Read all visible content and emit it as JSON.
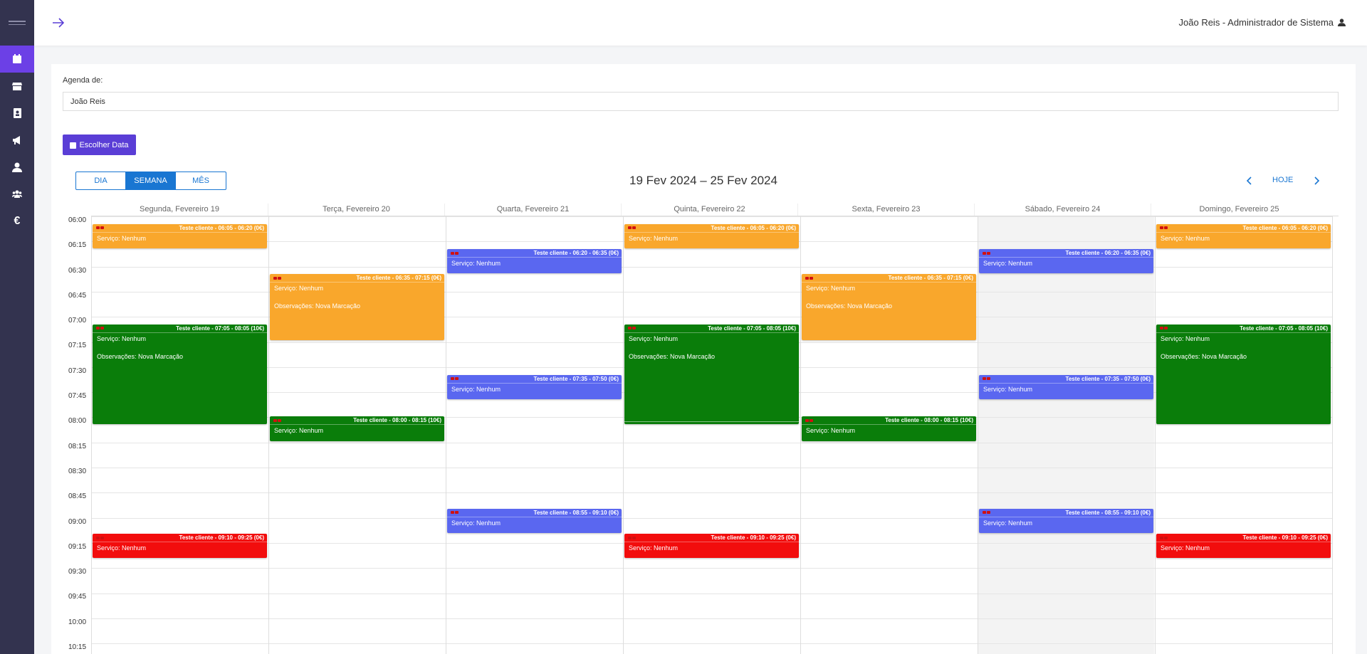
{
  "header": {
    "user_label": "João Reis - Administrador de Sistema"
  },
  "sidebar": {
    "items": [
      {
        "name": "calendar-icon",
        "active": true
      },
      {
        "name": "store-icon",
        "active": false
      },
      {
        "name": "contacts-icon",
        "active": false
      },
      {
        "name": "megaphone-icon",
        "active": false
      },
      {
        "name": "user-icon",
        "active": false
      },
      {
        "name": "users-icon",
        "active": false
      },
      {
        "name": "euro-icon",
        "active": false,
        "glyph": "€"
      }
    ]
  },
  "agenda": {
    "label": "Agenda de:",
    "value": "João Reis"
  },
  "toolbar": {
    "choose_date": "Escolher Data",
    "views": [
      "DIA",
      "SEMANA",
      "MÊS"
    ],
    "active_view": "SEMANA",
    "range": "19 Fev 2024 – 25 Fev 2024",
    "today": "HOJE"
  },
  "calendar": {
    "days": [
      "Segunda, Fevereiro 19",
      "Terça, Fevereiro 20",
      "Quarta, Fevereiro 21",
      "Quinta, Fevereiro 22",
      "Sexta, Fevereiro 23",
      "Sábado, Fevereiro 24",
      "Domingo, Fevereiro 25"
    ],
    "times": [
      "06:00",
      "06:15",
      "06:30",
      "06:45",
      "07:00",
      "07:15",
      "07:30",
      "07:45",
      "08:00",
      "08:15",
      "08:30",
      "08:45",
      "09:00",
      "09:15",
      "09:30",
      "09:45",
      "10:00",
      "10:15"
    ],
    "events": [
      {
        "day": 0,
        "start": "06:05",
        "end": "06:20",
        "color": "orange",
        "title": "Teste cliente - 06:05 - 06:20 (0€)",
        "servico": "Serviço: Nenhum"
      },
      {
        "day": 0,
        "start": "07:05",
        "end": "08:05",
        "color": "green",
        "title": "Teste cliente - 07:05 - 08:05 (10€)",
        "servico": "Serviço: Nenhum",
        "obs": "Observações: Nova Marcação"
      },
      {
        "day": 0,
        "start": "09:10",
        "end": "09:25",
        "color": "red",
        "title": "Teste cliente - 09:10 - 09:25 (0€)",
        "servico": "Serviço: Nenhum"
      },
      {
        "day": 1,
        "start": "06:35",
        "end": "07:15",
        "color": "orange",
        "title": "Teste cliente - 06:35 - 07:15 (0€)",
        "servico": "Serviço: Nenhum",
        "obs": "Observações: Nova Marcação"
      },
      {
        "day": 1,
        "start": "08:00",
        "end": "08:15",
        "color": "green",
        "title": "Teste cliente - 08:00 - 08:15 (10€)",
        "servico": "Serviço: Nenhum"
      },
      {
        "day": 2,
        "start": "06:20",
        "end": "06:35",
        "color": "blue",
        "title": "Teste cliente - 06:20 - 06:35 (0€)",
        "servico": "Serviço: Nenhum"
      },
      {
        "day": 2,
        "start": "07:35",
        "end": "07:50",
        "color": "blue",
        "title": "Teste cliente - 07:35 - 07:50 (0€)",
        "servico": "Serviço: Nenhum"
      },
      {
        "day": 2,
        "start": "08:55",
        "end": "09:10",
        "color": "blue",
        "title": "Teste cliente - 08:55 - 09:10 (0€)",
        "servico": "Serviço: Nenhum"
      },
      {
        "day": 3,
        "start": "06:05",
        "end": "06:20",
        "color": "orange",
        "title": "Teste cliente - 06:05 - 06:20 (0€)",
        "servico": "Serviço: Nenhum"
      },
      {
        "day": 3,
        "start": "07:05",
        "end": "08:05",
        "color": "green",
        "title": "Teste cliente - 07:05 - 08:05 (10€)",
        "servico": "Serviço: Nenhum",
        "obs": "Observações: Nova Marcação",
        "handle": true
      },
      {
        "day": 3,
        "start": "09:10",
        "end": "09:25",
        "color": "red",
        "title": "Teste cliente - 09:10 - 09:25 (0€)",
        "servico": "Serviço: Nenhum"
      },
      {
        "day": 4,
        "start": "06:35",
        "end": "07:15",
        "color": "orange",
        "title": "Teste cliente - 06:35 - 07:15 (0€)",
        "servico": "Serviço: Nenhum",
        "obs": "Observações: Nova Marcação"
      },
      {
        "day": 4,
        "start": "08:00",
        "end": "08:15",
        "color": "green",
        "title": "Teste cliente - 08:00 - 08:15 (10€)",
        "servico": "Serviço: Nenhum"
      },
      {
        "day": 5,
        "start": "06:20",
        "end": "06:35",
        "color": "blue",
        "title": "Teste cliente - 06:20 - 06:35 (0€)",
        "servico": "Serviço: Nenhum"
      },
      {
        "day": 5,
        "start": "07:35",
        "end": "07:50",
        "color": "blue",
        "title": "Teste cliente - 07:35 - 07:50 (0€)",
        "servico": "Serviço: Nenhum"
      },
      {
        "day": 5,
        "start": "08:55",
        "end": "09:10",
        "color": "blue",
        "title": "Teste cliente - 08:55 - 09:10 (0€)",
        "servico": "Serviço: Nenhum"
      },
      {
        "day": 6,
        "start": "06:05",
        "end": "06:20",
        "color": "orange",
        "title": "Teste cliente - 06:05 - 06:20 (0€)",
        "servico": "Serviço: Nenhum"
      },
      {
        "day": 6,
        "start": "07:05",
        "end": "08:05",
        "color": "green",
        "title": "Teste cliente - 07:05 - 08:05 (10€)",
        "servico": "Serviço: Nenhum",
        "obs": "Observações: Nova Marcação"
      },
      {
        "day": 6,
        "start": "09:10",
        "end": "09:25",
        "color": "red",
        "title": "Teste cliente - 09:10 - 09:25 (0€)",
        "servico": "Serviço: Nenhum"
      }
    ]
  }
}
